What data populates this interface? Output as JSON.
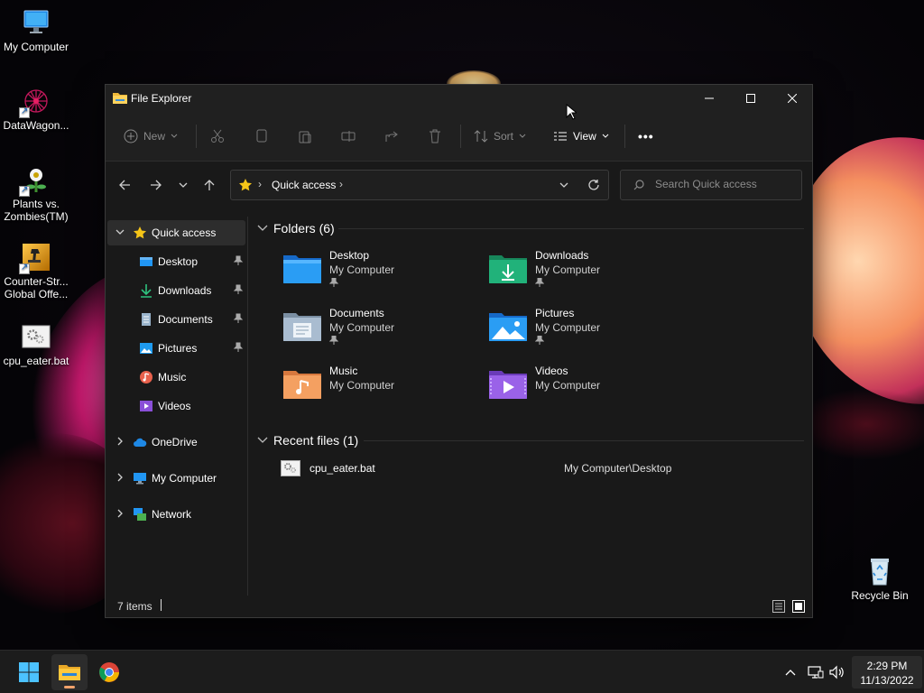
{
  "desktop": {
    "icons": [
      {
        "label": "My Computer",
        "icon": "monitor-icon"
      },
      {
        "label": "DataWagon...",
        "icon": "datawagon-icon"
      },
      {
        "label": "Plants vs. Zombies(TM)",
        "icon": "plants-vs-zombies-icon"
      },
      {
        "label": "Counter-Str... Global Offe...",
        "icon": "counter-strike-icon"
      },
      {
        "label": "cpu_eater.bat",
        "icon": "batch-file-icon"
      },
      {
        "label": "Recycle Bin",
        "icon": "recycle-bin-icon"
      }
    ]
  },
  "window": {
    "title": "File Explorer",
    "command_bar": {
      "new_label": "New",
      "sort_label": "Sort",
      "view_label": "View",
      "more_label": "•••"
    },
    "address": {
      "location": "Quick access"
    },
    "search": {
      "placeholder": "Search Quick access"
    },
    "sidebar": {
      "items": [
        {
          "label": "Quick access",
          "icon": "star-icon"
        },
        {
          "label": "Desktop",
          "icon": "desktop-folder-icon"
        },
        {
          "label": "Downloads",
          "icon": "download-icon"
        },
        {
          "label": "Documents",
          "icon": "document-icon"
        },
        {
          "label": "Pictures",
          "icon": "pictures-icon"
        },
        {
          "label": "Music",
          "icon": "music-icon"
        },
        {
          "label": "Videos",
          "icon": "videos-icon"
        },
        {
          "label": "OneDrive",
          "icon": "cloud-icon"
        },
        {
          "label": "My Computer",
          "icon": "monitor-icon"
        },
        {
          "label": "Network",
          "icon": "network-icon"
        }
      ]
    },
    "folders_header": "Folders (6)",
    "folders": [
      {
        "name": "Desktop",
        "location": "My Computer",
        "pinned": true
      },
      {
        "name": "Downloads",
        "location": "My Computer",
        "pinned": true
      },
      {
        "name": "Documents",
        "location": "My Computer",
        "pinned": true
      },
      {
        "name": "Pictures",
        "location": "My Computer",
        "pinned": true
      },
      {
        "name": "Music",
        "location": "My Computer",
        "pinned": false
      },
      {
        "name": "Videos",
        "location": "My Computer",
        "pinned": false
      }
    ],
    "recent_header": "Recent files (1)",
    "recent_files": [
      {
        "name": "cpu_eater.bat",
        "path": "My Computer\\Desktop"
      }
    ],
    "status": {
      "items": "7 items"
    }
  },
  "taskbar": {
    "apps": [
      "start-icon",
      "file-explorer-icon",
      "chrome-icon"
    ],
    "clock": {
      "time": "2:29 PM",
      "date": "11/13/2022"
    }
  },
  "colors": {
    "window_bg": "#191919",
    "accent_star": "#f5c518",
    "taskbar_indicator": "#f2a36b"
  }
}
